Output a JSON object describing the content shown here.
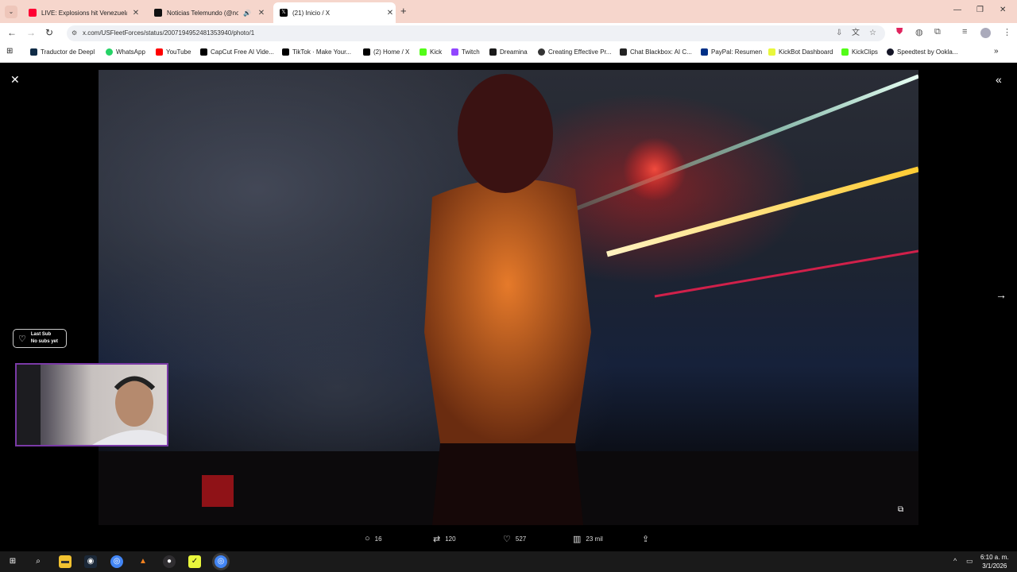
{
  "browser": {
    "tabs": [
      {
        "title": "LIVE: Explosions hit Venezuela's",
        "fav_color": "#ff0033",
        "active": false
      },
      {
        "title": "Noticias Telemundo (@noti",
        "fav_color": "#111111",
        "active": false
      },
      {
        "title": "(21) Inicio / X",
        "fav_color": "#000000",
        "active": true
      }
    ],
    "url": "x.com/USFleetForces/status/2007194952481353940/photo/1",
    "bookmarks": [
      {
        "label": "Traductor de Deepl",
        "color": "#0f2b46"
      },
      {
        "label": "WhatsApp",
        "color": "#25d366"
      },
      {
        "label": "YouTube",
        "color": "#ff0000"
      },
      {
        "label": "CapCut Free AI Vide...",
        "color": "#000000"
      },
      {
        "label": "TikTok · Make Your...",
        "color": "#000000"
      },
      {
        "label": "(2) Home / X",
        "color": "#000000"
      },
      {
        "label": "Kick",
        "color": "#53fc18"
      },
      {
        "label": "Twitch",
        "color": "#9146ff"
      },
      {
        "label": "Dreamina",
        "color": "#1a1a1a"
      },
      {
        "label": "Creating Effective Pr...",
        "color": "#333333"
      },
      {
        "label": "Chat Blackbox: AI C...",
        "color": "#222222"
      },
      {
        "label": "PayPal: Resumen",
        "color": "#003087"
      },
      {
        "label": "KickBot Dashboard",
        "color": "#e9f73c"
      },
      {
        "label": "KickClips",
        "color": "#53fc18"
      },
      {
        "label": "Speedtest by Ookla...",
        "color": "#141526"
      }
    ]
  },
  "post_actions": {
    "replies": "16",
    "reposts": "120",
    "likes": "527",
    "views": "23 mil"
  },
  "overlay": {
    "sub_title": "Last Sub",
    "sub_value": "No subs yet"
  },
  "taskbar": {
    "time": "6:10 a. m.",
    "date": "3/1/2026"
  }
}
